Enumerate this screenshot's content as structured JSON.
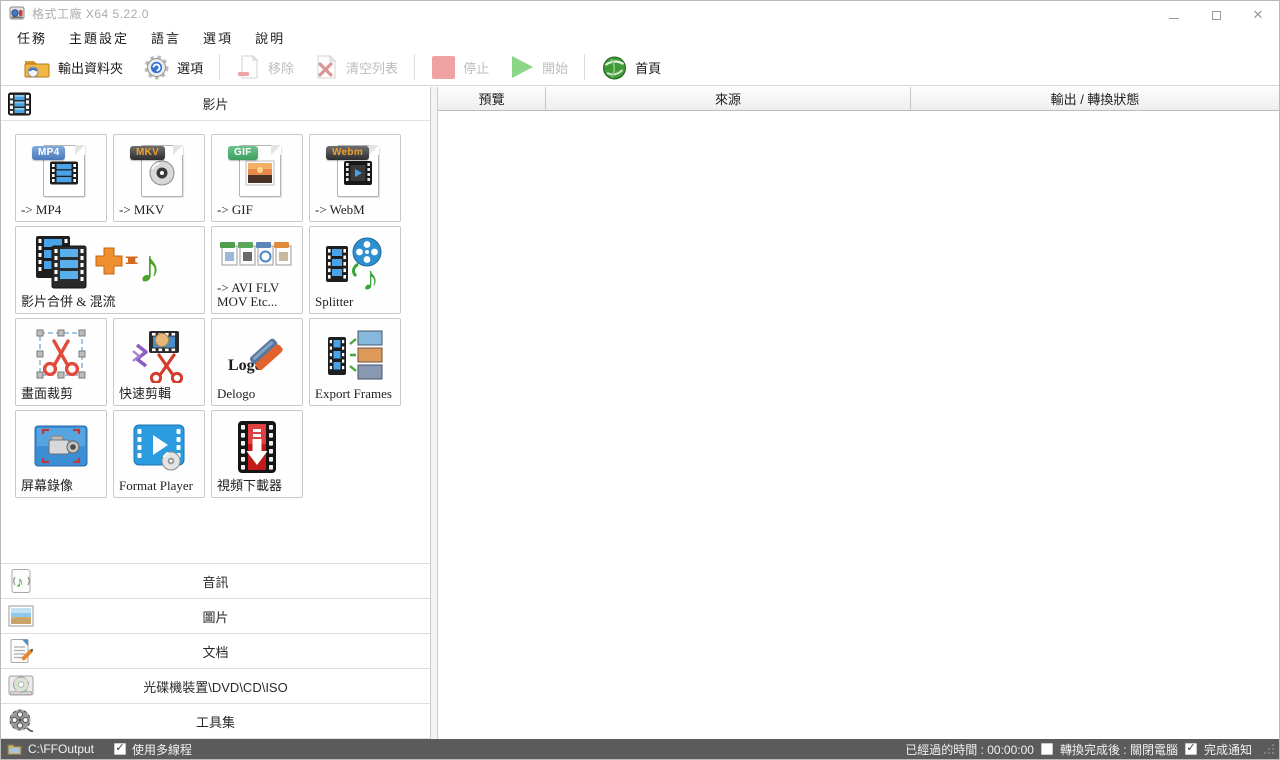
{
  "window": {
    "title": "格式工廠 X64 5.22.0"
  },
  "menubar": {
    "items": [
      "任務",
      "主題設定",
      "語言",
      "選項",
      "說明"
    ]
  },
  "toolbar": {
    "output_folder": "輸出資料夾",
    "options": "選項",
    "remove": "移除",
    "clear_list": "清空列表",
    "stop": "停止",
    "start": "開始",
    "home": "首頁"
  },
  "sidebar": {
    "video_header": "影片",
    "tiles": [
      {
        "label": "-> MP4",
        "badge": "MP4"
      },
      {
        "label": "-> MKV",
        "badge": "MKV"
      },
      {
        "label": "-> GIF",
        "badge": "GIF"
      },
      {
        "label": "-> WebM",
        "badge": "Webm"
      },
      {
        "label": "影片合併 & 混流"
      },
      {
        "label": "-> AVI FLV MOV Etc..."
      },
      {
        "label": "Splitter"
      },
      {
        "label": "畫面裁剪"
      },
      {
        "label": "快速剪輯"
      },
      {
        "label": "Delogo",
        "icon_text": "Logo"
      },
      {
        "label": "Export Frames"
      },
      {
        "label": "屏幕錄像"
      },
      {
        "label": "Format Player"
      },
      {
        "label": "視頻下載器"
      }
    ],
    "categories": [
      "音訊",
      "圖片",
      "文档",
      "光碟機裝置\\DVD\\CD\\ISO",
      "工具集"
    ]
  },
  "filelist": {
    "columns": [
      "預覽",
      "來源",
      "輸出 / 轉換狀態"
    ]
  },
  "statusbar": {
    "output_path": "C:\\FFOutput",
    "multithread": "使用多線程",
    "multithread_checked": true,
    "elapsed": "已經過的時間 : 00:00:00",
    "shutdown": "轉換完成後 : 關閉電腦",
    "shutdown_checked": false,
    "notify": "完成通知",
    "notify_checked": true
  }
}
